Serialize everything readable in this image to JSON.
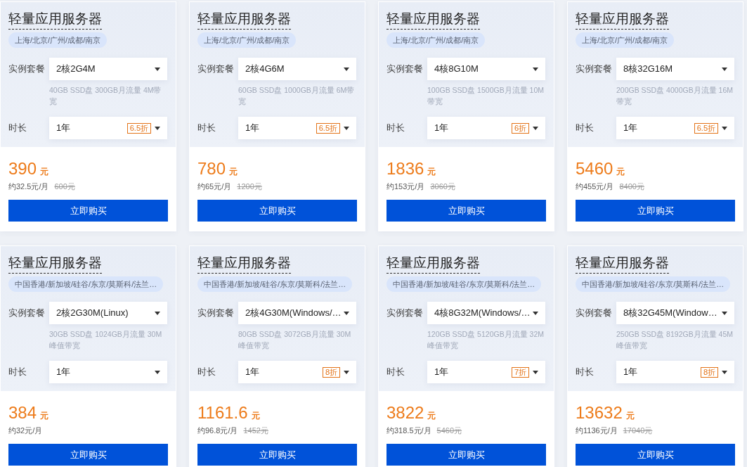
{
  "cards": [
    {
      "title": "轻量应用服务器",
      "regions": "上海/北京/广州/成都/南京",
      "plan_label": "实例套餐",
      "plan": "2核2G4M",
      "spec": "40GB SSD盘 300GB月流量 4M带宽",
      "duration_label": "时长",
      "duration": "1年",
      "discount": "6.5折",
      "price": "390",
      "currency": "元",
      "monthly": "约32.5元/月",
      "original_price": "600元",
      "buy": "立即购买"
    },
    {
      "title": "轻量应用服务器",
      "regions": "上海/北京/广州/成都/南京",
      "plan_label": "实例套餐",
      "plan": "2核4G6M",
      "spec": "60GB SSD盘 1000GB月流量 6M带宽",
      "duration_label": "时长",
      "duration": "1年",
      "discount": "6.5折",
      "price": "780",
      "currency": "元",
      "monthly": "约65元/月",
      "original_price": "1200元",
      "buy": "立即购买"
    },
    {
      "title": "轻量应用服务器",
      "regions": "上海/北京/广州/成都/南京",
      "plan_label": "实例套餐",
      "plan": "4核8G10M",
      "spec": "100GB SSD盘 1500GB月流量 10M带宽",
      "duration_label": "时长",
      "duration": "1年",
      "discount": "6折",
      "price": "1836",
      "currency": "元",
      "monthly": "约153元/月",
      "original_price": "3060元",
      "buy": "立即购买"
    },
    {
      "title": "轻量应用服务器",
      "regions": "上海/北京/广州/成都/南京",
      "plan_label": "实例套餐",
      "plan": "8核32G16M",
      "spec": "200GB SSD盘 4000GB月流量 16M带宽",
      "duration_label": "时长",
      "duration": "1年",
      "discount": "6.5折",
      "price": "5460",
      "currency": "元",
      "monthly": "约455元/月",
      "original_price": "8400元",
      "buy": "立即购买"
    },
    {
      "title": "轻量应用服务器",
      "regions": "中国香港/新加坡/硅谷/东京/莫斯科/法兰…",
      "plan_label": "实例套餐",
      "plan": "2核2G30M(Linux)",
      "spec": "30GB SSD盘 1024GB月流量 30M峰值带宽",
      "duration_label": "时长",
      "duration": "1年",
      "price": "384",
      "currency": "元",
      "monthly": "约32元/月",
      "buy": "立即购买"
    },
    {
      "title": "轻量应用服务器",
      "regions": "中国香港/新加坡/硅谷/东京/莫斯科/法兰…",
      "plan_label": "实例套餐",
      "plan": "2核4G30M(Windows/…",
      "spec": "80GB SSD盘 3072GB月流量 30M峰值带宽",
      "duration_label": "时长",
      "duration": "1年",
      "discount": "8折",
      "price": "1161.6",
      "currency": "元",
      "monthly": "约96.8元/月",
      "original_price": "1452元",
      "buy": "立即购买"
    },
    {
      "title": "轻量应用服务器",
      "regions": "中国香港/新加坡/硅谷/东京/莫斯科/法兰…",
      "plan_label": "实例套餐",
      "plan": "4核8G32M(Windows/…",
      "spec": "120GB SSD盘 5120GB月流量 32M峰值带宽",
      "duration_label": "时长",
      "duration": "1年",
      "discount": "7折",
      "price": "3822",
      "currency": "元",
      "monthly": "约318.5元/月",
      "original_price": "5460元",
      "buy": "立即购买"
    },
    {
      "title": "轻量应用服务器",
      "regions": "中国香港/新加坡/硅谷/东京/莫斯科/法兰…",
      "plan_label": "实例套餐",
      "plan": "8核32G45M(Window…",
      "spec": "250GB SSD盘 8192GB月流量 45M峰值带宽",
      "duration_label": "时长",
      "duration": "1年",
      "discount": "8折",
      "price": "13632",
      "currency": "元",
      "monthly": "约1136元/月",
      "original_price": "17040元",
      "buy": "立即购买"
    }
  ]
}
